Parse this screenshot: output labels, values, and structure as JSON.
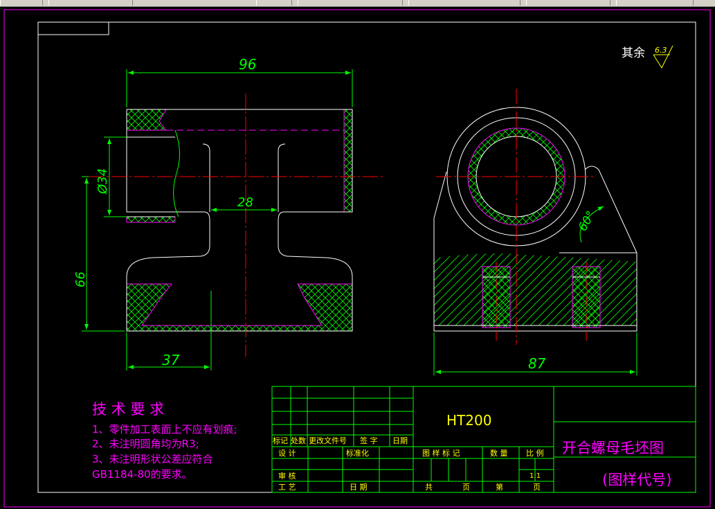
{
  "colors": {
    "background": "#000000",
    "border": "#ff00ff",
    "outline": "#ffffff",
    "dimension": "#00ff00",
    "centerline": "#ff0000",
    "hatch": "#00ff00",
    "hidden": "#ff00ff",
    "notes": "#ff00ff",
    "title_text": "#ffff00",
    "title_name": "#ff00ff",
    "table_lines": "#00ff00",
    "table_text": "#ffff00"
  },
  "toolbar": {
    "icons": [
      "zoom-icon",
      "layer-icon",
      "color-icon"
    ]
  },
  "dimensions": {
    "width_96": "96",
    "bore_34": "Ø34",
    "inner_28": "28",
    "height_66": "66",
    "base_37": "37",
    "width_87": "87",
    "angle_60": "60°"
  },
  "roughness": {
    "label": "其余",
    "value": "6.3"
  },
  "tech_req": {
    "title": "技 术 要 求",
    "lines": [
      "1、零件加工表面上不应有划痕;",
      "2、未注明圆角均为R3;",
      "3、未注明形状公差应符合",
      "GB1184-80的要求。"
    ]
  },
  "title_block": {
    "material": "HT200",
    "part_name": "开合螺母毛坯图",
    "drawing_code": "(图样代号)",
    "rev_headers": [
      "标记",
      "处数",
      "更改文件号",
      "签 字",
      "日期"
    ],
    "design": "设 计",
    "standardize": "标准化",
    "review": "审 核",
    "process": "工 艺",
    "date": "日 期",
    "pattern_mark": "图 样 标 记",
    "quantity": "数 量",
    "scale_label": "比 例",
    "scale_value": "1:1",
    "total": "共",
    "sheet": "页",
    "page_no": "第",
    "page": "页"
  }
}
